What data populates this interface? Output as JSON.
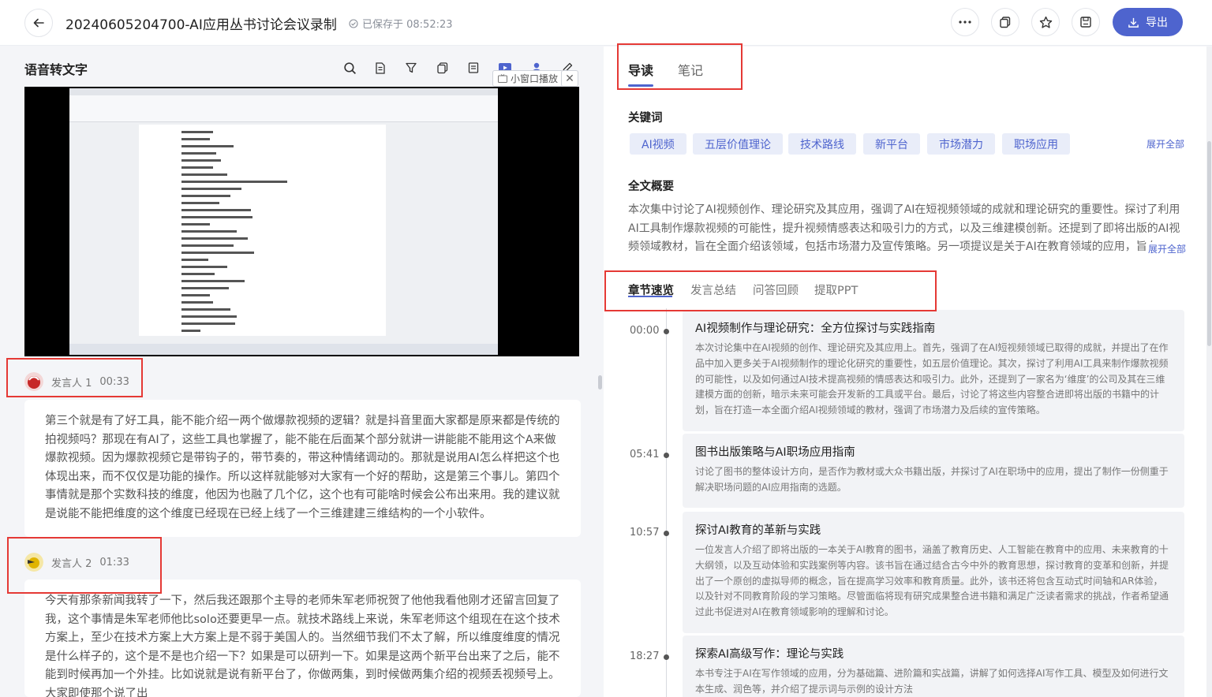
{
  "header": {
    "title": "20240605204700-AI应用丛书讨论会议录制",
    "save_status": "已保存于 08:52:23",
    "export_label": "导出"
  },
  "left_panel": {
    "heading": "语音转文字",
    "mini_play_label": "小窗口播放",
    "mini_close": "✕",
    "segments": [
      {
        "speaker": "发言人 1",
        "time": "00:33",
        "text": "第三个就是有了好工具，能不能介绍一两个做爆款视频的逻辑？就是抖音里面大家都是原来都是传统的拍视频吗？那现在有AI了，这些工具也掌握了，能不能在后面某个部分就讲一讲能能不能用这个A来做爆款视频。因为爆款视频它是带钩子的，带节奏的，带这种情绪调动的。那就是说用AI怎么样把这个也体现出来，而不仅仅是功能的操作。所以这样就能够对大家有一个好的帮助，这是第三个事儿。第四个事情就是那个实数科技的维度，他因为也融了几个亿，这个也有可能啥时候会公布出来用。我的建议就是说能不能把维度的这个维度已经现在已经上线了一个三维建建三维结构的一个小软件。"
      },
      {
        "speaker": "发言人 2",
        "time": "01:33",
        "text": "今天有那条新闻我转了一下，然后我还跟那个主导的老师朱军老师祝贺了他他我看他刚才还留言回复了我，这个事情是朱军老师他比solo还要更早一点。就技术路线上来说，朱军老师这个组现在在这个技术方案上，至少在技术方案上大方案上是不弱于美国人的。当然细节我们不太了解，所以维度维度的情况是什么样子的，这个是不是也介绍一下？如果是可以研判一下。如果是这两个新平台出来了之后，能不能到时候再加一个外挂。比如说就是说有新平台了，你做两集，到时候做两集介绍的视频丢视频号上。大家即使那个说了出"
      }
    ]
  },
  "right_panel": {
    "tabs": [
      "导读",
      "笔记"
    ],
    "keywords_heading": "关键词",
    "keywords": [
      "AI视频",
      "五层价值理论",
      "技术路线",
      "新平台",
      "市场潜力",
      "职场应用"
    ],
    "expand_all": "展开全部",
    "summary_heading": "全文概要",
    "summary": "本次集中讨论了AI视频创作、理论研究及其应用，强调了AI在短视频领域的成就和理论研究的重要性。探讨了利用AI工具制作爆款视频的可能性，提升视频情感表达和吸引力的方式，以及三维建模创新。还提到了即将出版的AI视频领域教材，旨在全面介绍该领域，包括市场潜力及宣传策略。另一项提议是关于AI在教育领域的应用，旨在…",
    "summary_expand": "展开全部",
    "subtabs": [
      "章节速览",
      "发言总结",
      "问答回顾",
      "提取PPT"
    ],
    "chapters": [
      {
        "time": "00:00",
        "title": "AI视频制作与理论研究：全方位探讨与实践指南",
        "body": "本次讨论集中在AI视频的创作、理论研究及其应用上。首先，强调了在AI短视频领域已取得的成就，并提出了在作品中加入更多关于AI视频制作的理论化研究的重要性，如五层价值理论。其次，探讨了利用AI工具来制作爆款视频的可能性，以及如何通过AI技术提高视频的情感表达和吸引力。此外，还提到了一家名为‘维度’的公司及其在三维建模方面的创新，暗示未来可能会开发新的工具或平台。最后，讨论了将这些内容整合进即将出版的书籍中的计划，旨在打造一本全面介绍AI视频领域的教材，强调了市场潜力及后续的宣传策略。"
      },
      {
        "time": "05:41",
        "title": "图书出版策略与AI职场应用指南",
        "body": "讨论了图书的整体设计方向，是否作为教材或大众书籍出版，并探讨了AI在职场中的应用，提出了制作一份侧重于解决职场问题的AI应用指南的选题。"
      },
      {
        "time": "10:57",
        "title": "探讨AI教育的革新与实践",
        "body": "一位发言人介绍了即将出版的一本关于AI教育的图书，涵盖了教育历史、人工智能在教育中的应用、未来教育的十大纲领，以及互动体验和实践案例等内容。该书旨在通过结合古今中外的教育思想，探讨教育的变革和创新，并提出了一个原创的虚拟导师的概念，旨在提高学习效率和教育质量。此外，该书还将包含互动式时间轴和AR体验，以及针对不同教育阶段的学习策略。尽管面临将现有研究成果整合进书籍和满足广泛读者需求的挑战，作者希望通过此书促进对AI在教育领域影响的理解和讨论。"
      },
      {
        "time": "18:27",
        "title": "探索AI高级写作：理论与实践",
        "body": "本书专注于AI在写作领域的应用，分为基础篇、进阶篇和实战篇，讲解了如何选择AI写作工具、模型及如何进行文本生成、润色等，并介绍了提示词与示例的设计方法"
      }
    ]
  }
}
